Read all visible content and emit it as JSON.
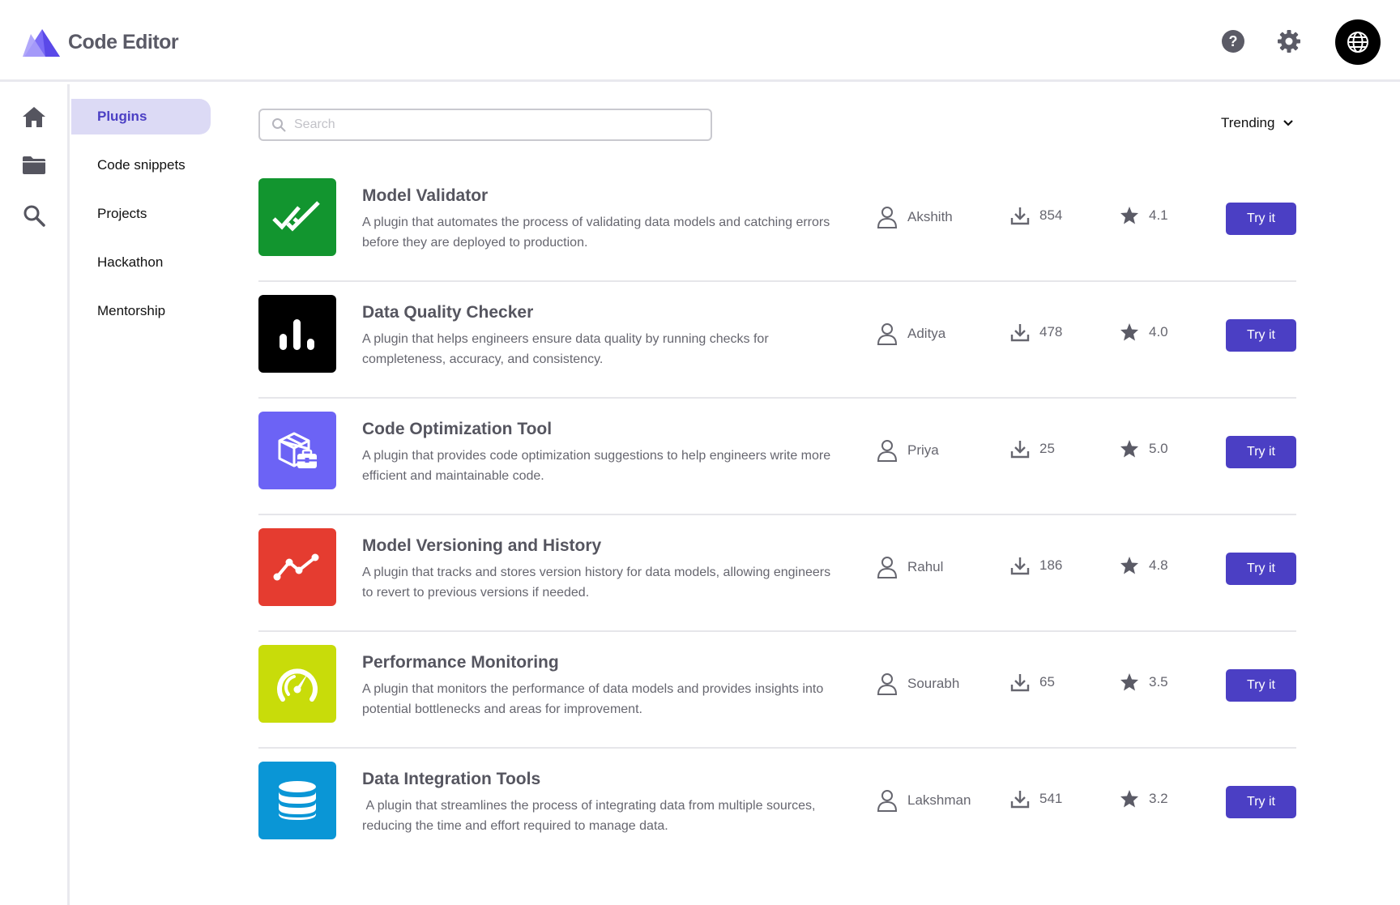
{
  "header": {
    "app_title": "Code Editor",
    "icons": [
      "help-circle-icon",
      "gear-icon",
      "globe-icon"
    ]
  },
  "rail": {
    "icons": [
      "home-icon",
      "folder-icon",
      "search-icon"
    ]
  },
  "nav": {
    "items": [
      {
        "label": "Plugins",
        "active": true
      },
      {
        "label": "Code snippets",
        "active": false
      },
      {
        "label": "Projects",
        "active": false
      },
      {
        "label": "Hackathon",
        "active": false
      },
      {
        "label": "Mentorship",
        "active": false
      }
    ]
  },
  "search": {
    "placeholder": "Search",
    "value": ""
  },
  "sort": {
    "label": "Trending"
  },
  "colors": {
    "accent": "#4b3fc4",
    "active_nav_bg": "#dcdaf5"
  },
  "plugins": [
    {
      "title": "Model Validator",
      "description": "A plugin that automates the process of validating data models and catching errors before they are deployed to production.",
      "author": "Akshith",
      "downloads": "854",
      "rating": "4.1",
      "action": "Try it",
      "tile_color": "#12952f",
      "icon": "double-check-icon"
    },
    {
      "title": "Data Quality Checker",
      "description": "A plugin that helps engineers ensure data quality by running checks for completeness, accuracy, and consistency.",
      "author": "Aditya",
      "downloads": "478",
      "rating": "4.0",
      "action": "Try it",
      "tile_color": "#000000",
      "icon": "bar-chart-icon"
    },
    {
      "title": "Code Optimization Tool",
      "description": "A plugin that provides code optimization suggestions to help engineers write more efficient and maintainable code.",
      "author": "Priya",
      "downloads": "25",
      "rating": "5.0",
      "action": "Try it",
      "tile_color": "#6c63f5",
      "icon": "package-toolbox-icon"
    },
    {
      "title": "Model Versioning and History",
      "description": "A plugin that tracks and stores version history for data models, allowing engineers to revert to previous versions if needed.",
      "author": "Rahul",
      "downloads": "186",
      "rating": "4.8",
      "action": "Try it",
      "tile_color": "#e53c30",
      "icon": "trend-line-icon"
    },
    {
      "title": "Performance Monitoring",
      "description": "A plugin that monitors the performance of data models and provides insights into potential bottlenecks and areas for improvement.",
      "author": "Sourabh",
      "downloads": "65",
      "rating": "3.5",
      "action": "Try it",
      "tile_color": "#c8dc0a",
      "icon": "speedometer-icon"
    },
    {
      "title": "Data Integration Tools",
      "description": " A plugin that streamlines the process of integrating data from multiple sources, reducing the time and effort required to manage data.",
      "author": "Lakshman",
      "downloads": "541",
      "rating": "3.2",
      "action": "Try it",
      "tile_color": "#0a96d6",
      "icon": "database-icon"
    }
  ]
}
